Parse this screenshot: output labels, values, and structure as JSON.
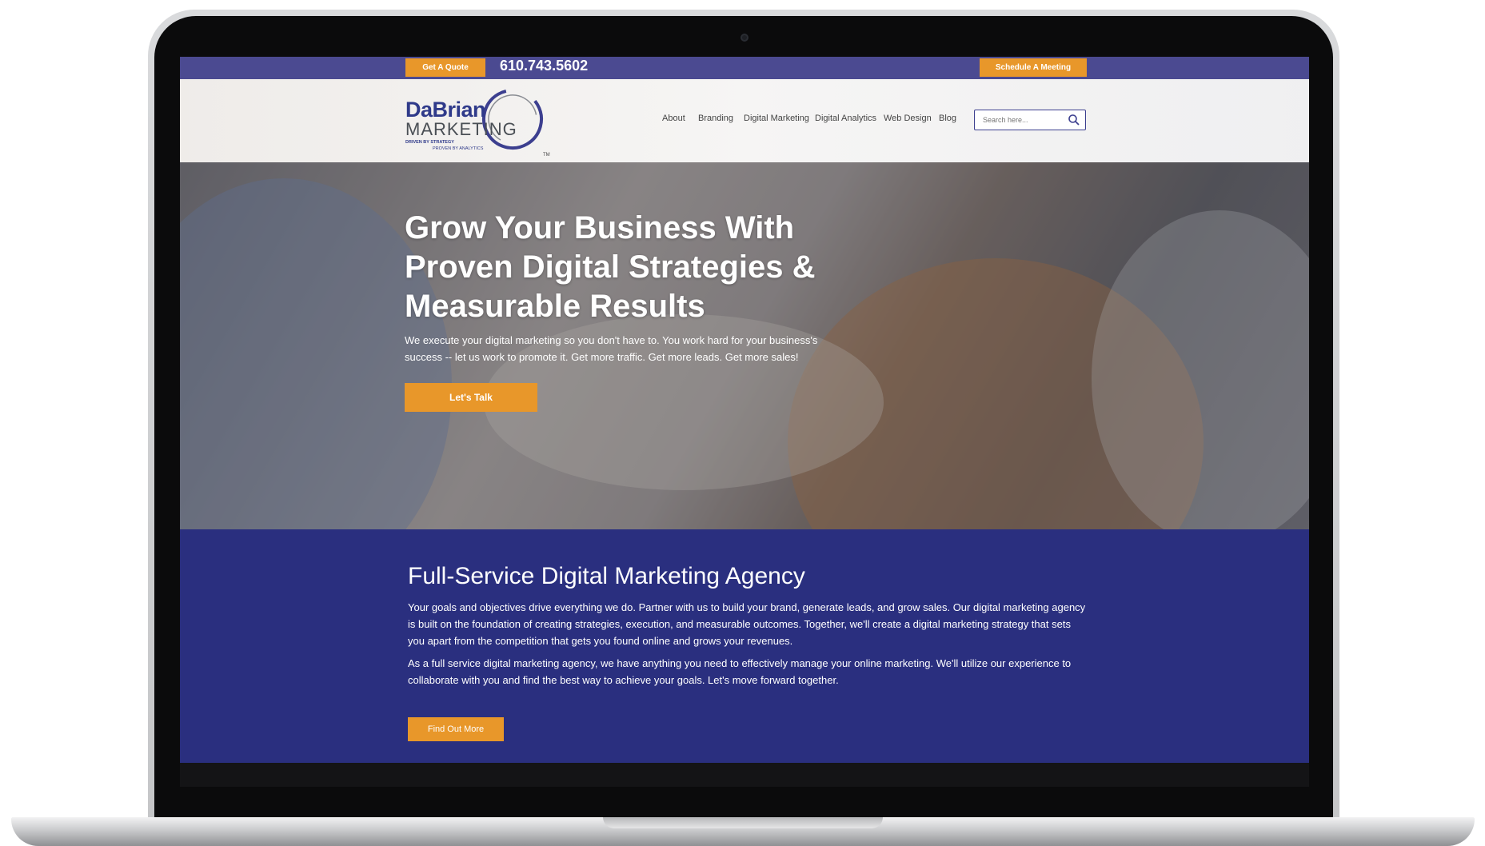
{
  "topbar": {
    "quote_label": "Get A Quote",
    "phone": "610.743.5602",
    "meeting_label": "Schedule A Meeting"
  },
  "logo": {
    "title": "DaBrian",
    "subtitle": "MARKETING",
    "tagline1": "DRIVEN BY STRATEGY",
    "tagline2": "PROVEN BY ANALYTICS",
    "tm": "TM"
  },
  "nav": {
    "items": [
      "About",
      "Branding",
      "Digital Marketing",
      "Digital Analytics",
      "Web Design",
      "Blog"
    ]
  },
  "search": {
    "placeholder": "Search here..."
  },
  "hero": {
    "title_line1": "Grow Your Business With",
    "title_line2": "Proven Digital Strategies &",
    "title_line3": "Measurable Results",
    "text": "We execute your digital marketing so you don't have to. You work hard for your business's success -- let us work to promote it. Get more traffic. Get more leads. Get more sales!",
    "button_label": "Let's Talk"
  },
  "agency": {
    "title": "Full-Service Digital Marketing Agency",
    "paragraph1": "Your goals and objectives drive everything we do. Partner with us to build your brand, generate leads, and grow sales. Our digital marketing agency is built on the foundation of creating strategies, execution, and measurable outcomes. Together, we'll create a digital marketing strategy that sets you apart from the competition that gets you found online and grows your revenues.",
    "paragraph2": "As a full service digital marketing agency, we have anything you need to effectively manage your online marketing. We'll utilize our experience to collaborate with you and find the best way to achieve your goals. Let's move forward together.",
    "button_label": "Find Out More"
  },
  "colors": {
    "brand_purple": "#4b4a91",
    "brand_navy": "#2a2f7f",
    "accent_orange": "#e8972a"
  }
}
